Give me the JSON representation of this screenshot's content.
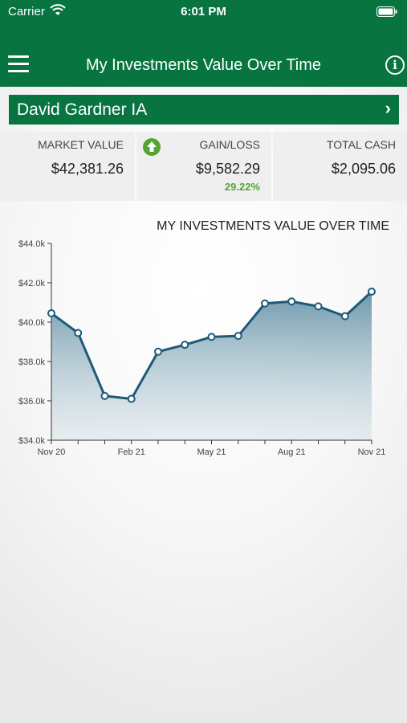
{
  "status": {
    "carrier": "Carrier",
    "time": "6:01 PM"
  },
  "nav": {
    "title": "My Investments Value Over Time",
    "info": "i"
  },
  "account": {
    "name": "David Gardner IA"
  },
  "summary": {
    "market_value": {
      "label": "MARKET VALUE",
      "value": "$42,381.26"
    },
    "gain_loss": {
      "label": "GAIN/LOSS",
      "value": "$9,582.29",
      "percent": "29.22%"
    },
    "total_cash": {
      "label": "TOTAL CASH",
      "value": "$2,095.06"
    }
  },
  "colors": {
    "brand_green": "#087440",
    "line": "#1e5a78",
    "gain": "#52a630"
  },
  "chart_data": {
    "type": "area",
    "title": "MY INVESTMENTS VALUE OVER TIME",
    "xlabel": "",
    "ylabel": "",
    "x_tick_labels": [
      "Nov 20",
      "Feb 21",
      "May 21",
      "Aug 21",
      "Nov 21"
    ],
    "y_tick_labels": [
      "$34.0k",
      "$36.0k",
      "$38.0k",
      "$40.0k",
      "$42.0k",
      "$44.0k"
    ],
    "ylim": [
      34000,
      44000
    ],
    "x": [
      "Nov 20",
      "Dec 20",
      "Jan 21",
      "Feb 21",
      "Mar 21",
      "Apr 21",
      "May 21",
      "Jun 21",
      "Jul 21",
      "Aug 21",
      "Sep 21",
      "Oct 21",
      "Nov 21"
    ],
    "values": [
      40450,
      39450,
      36250,
      36100,
      38500,
      38850,
      39250,
      39300,
      40950,
      41050,
      40800,
      40300,
      41550
    ],
    "grid": false,
    "legend": "none"
  }
}
